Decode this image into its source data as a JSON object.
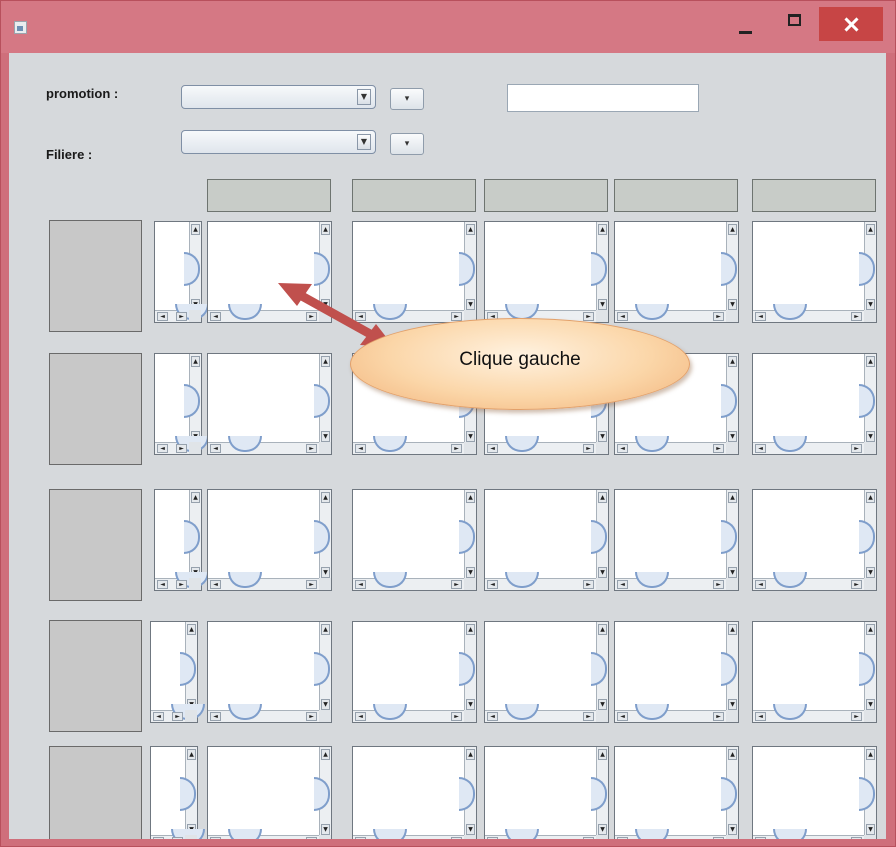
{
  "window": {
    "title": "",
    "controls": {
      "minimize": "minimize",
      "maximize": "maximize",
      "close": "close"
    }
  },
  "form": {
    "promotion_label": "promotion :",
    "filiere_label": "Filiere :",
    "promotion_value": "",
    "filiere_value": "",
    "search_value": ""
  },
  "grid": {
    "rows": 5,
    "columns": 5
  },
  "annotation": {
    "callout_text": "Clique gauche"
  },
  "colors": {
    "title_bar": "#d57884",
    "content_bg": "#d6d9dc",
    "close_button": "#c74545",
    "callout_fill": "#fbd6a8",
    "arrow": "#c0504d"
  }
}
